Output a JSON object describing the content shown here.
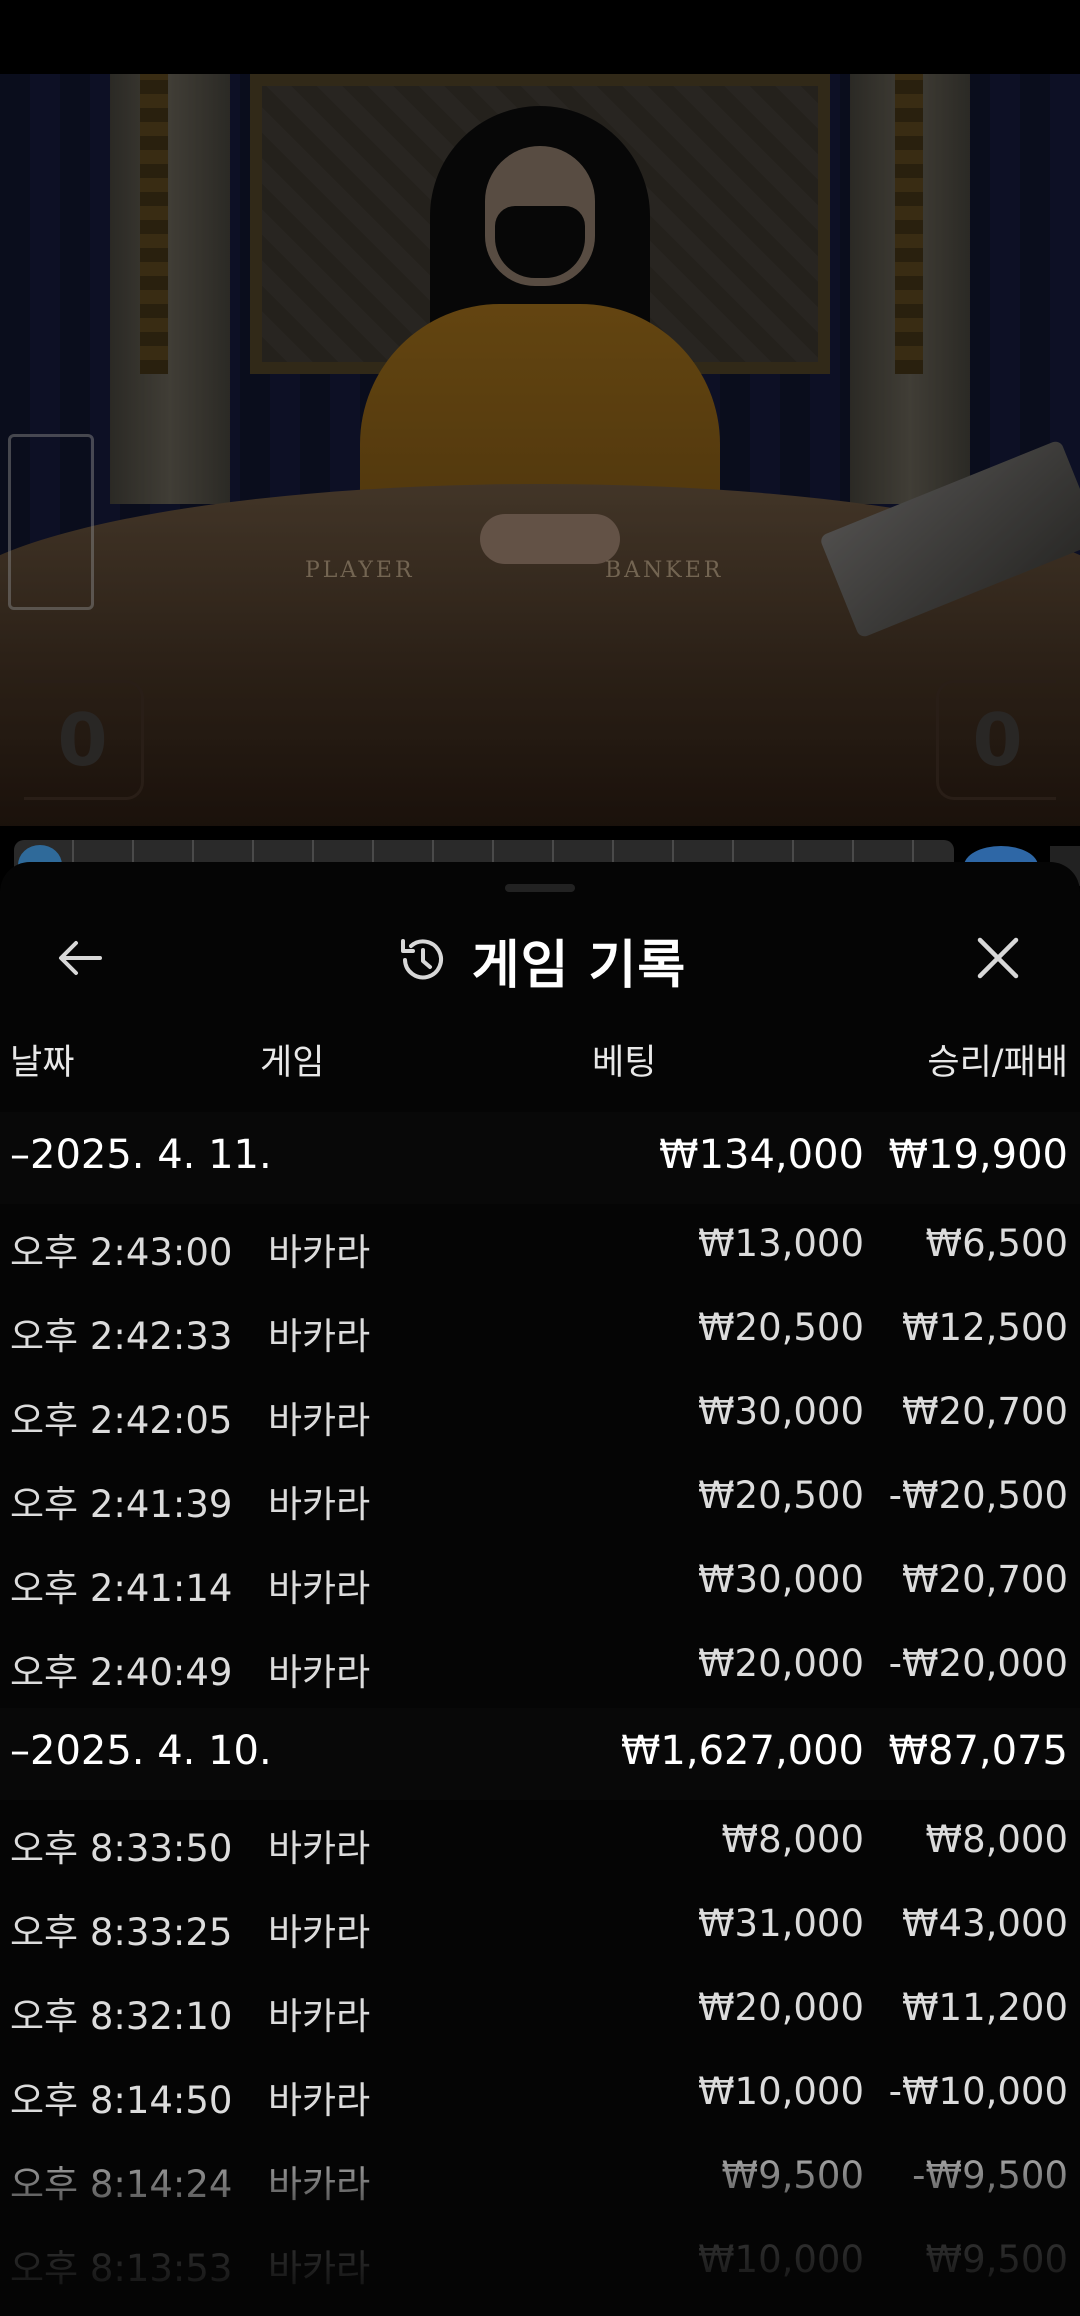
{
  "video": {
    "table_labels": [
      "PLAYER",
      "BANKER"
    ],
    "player_score": "0",
    "banker_score": "0"
  },
  "sheet": {
    "title": "게임 기록",
    "icons": {
      "back": "back-arrow-icon",
      "history": "history-icon",
      "close": "close-icon"
    }
  },
  "columns": {
    "date": "날짜",
    "game": "게임",
    "bet": "베팅",
    "result": "승리/패배"
  },
  "groups": [
    {
      "date": "–2025. 4. 11.",
      "bet_total": "₩134,000",
      "result_total": "₩19,900",
      "rows": [
        {
          "time": "오후 2:43:00",
          "game": "바카라",
          "bet": "₩13,000",
          "result": "₩6,500"
        },
        {
          "time": "오후 2:42:33",
          "game": "바카라",
          "bet": "₩20,500",
          "result": "₩12,500"
        },
        {
          "time": "오후 2:42:05",
          "game": "바카라",
          "bet": "₩30,000",
          "result": "₩20,700"
        },
        {
          "time": "오후 2:41:39",
          "game": "바카라",
          "bet": "₩20,500",
          "result": "-₩20,500"
        },
        {
          "time": "오후 2:41:14",
          "game": "바카라",
          "bet": "₩30,000",
          "result": "₩20,700"
        },
        {
          "time": "오후 2:40:49",
          "game": "바카라",
          "bet": "₩20,000",
          "result": "-₩20,000"
        }
      ]
    },
    {
      "date": "–2025. 4. 10.",
      "bet_total": "₩1,627,000",
      "result_total": "₩87,075",
      "rows": [
        {
          "time": "오후 8:33:50",
          "game": "바카라",
          "bet": "₩8,000",
          "result": "₩8,000"
        },
        {
          "time": "오후 8:33:25",
          "game": "바카라",
          "bet": "₩31,000",
          "result": "₩43,000"
        },
        {
          "time": "오후 8:32:10",
          "game": "바카라",
          "bet": "₩20,000",
          "result": "₩11,200"
        },
        {
          "time": "오후 8:14:50",
          "game": "바카라",
          "bet": "₩10,000",
          "result": "-₩10,000"
        },
        {
          "time": "오후 8:14:24",
          "game": "바카라",
          "bet": "₩9,500",
          "result": "-₩9,500"
        },
        {
          "time": "오후 8:13:53",
          "game": "바카라",
          "bet": "₩10,000",
          "result": "₩9,500"
        }
      ]
    }
  ]
}
